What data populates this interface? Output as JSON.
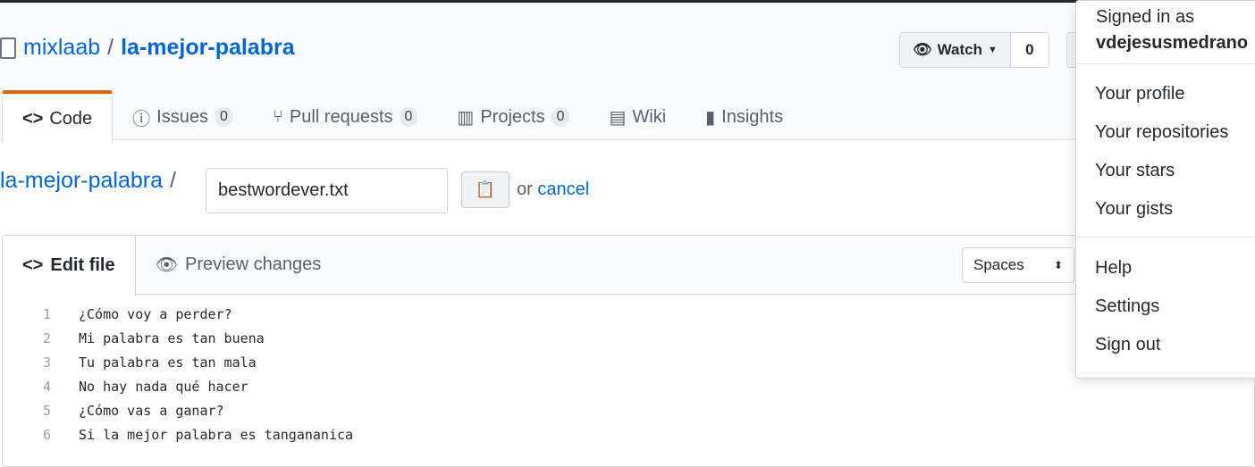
{
  "repo": {
    "owner": "mixlaab",
    "name": "la-mejor-palabra"
  },
  "watch": {
    "label": "Watch",
    "count": "0"
  },
  "tabs": [
    {
      "label": "Code"
    },
    {
      "label": "Issues",
      "count": "0"
    },
    {
      "label": "Pull requests",
      "count": "0"
    },
    {
      "label": "Projects",
      "count": "0"
    },
    {
      "label": "Wiki"
    },
    {
      "label": "Insights"
    }
  ],
  "path": {
    "repo": "la-mejor-palabra",
    "sep": "/",
    "filename": "bestwordever.txt",
    "or": "or",
    "cancel": "cancel"
  },
  "editor": {
    "edit_tab": "Edit file",
    "preview_tab": "Preview changes",
    "indent": "Spaces",
    "lines": [
      {
        "n": "1",
        "t": "¿Cómo voy a perder?"
      },
      {
        "n": "2",
        "t": "Mi palabra es tan buena"
      },
      {
        "n": "3",
        "t": "Tu palabra es tan mala"
      },
      {
        "n": "4",
        "t": "No hay nada qué hacer"
      },
      {
        "n": "5",
        "t": "¿Cómo vas a ganar?"
      },
      {
        "n": "6",
        "t": "Si la mejor palabra es tangananica"
      }
    ]
  },
  "menu": {
    "signed_in": "Signed in as",
    "user": "vdejesusmedrano",
    "items": [
      "Your profile",
      "Your repositories",
      "Your stars",
      "Your gists"
    ],
    "items2": [
      "Help",
      "Settings",
      "Sign out"
    ]
  }
}
